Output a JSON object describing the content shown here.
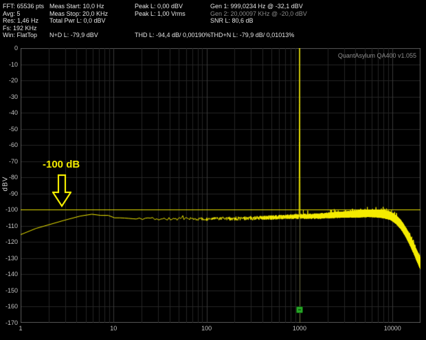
{
  "header": {
    "col1": {
      "rows": [
        "FFT: 65536 pts",
        "Avg: 5",
        "Res: 1,46 Hz",
        "Fs: 192 KHz",
        "Win: FlatTop"
      ]
    },
    "col2": {
      "rows": [
        "Meas Start: 10,0 Hz",
        "Meas Stop: 20,0 KHz",
        "Total Pwr L: 0,0 dBV",
        "",
        "N+D L: -79,9 dBV"
      ]
    },
    "col3": {
      "rows": [
        "Peak L: 0,00 dBV",
        "Peak L: 1,00 Vrms",
        "",
        "",
        "THD L: -94,4 dB/ 0,00190%"
      ]
    },
    "col4": {
      "rows": [
        "Gen 1: 999,0234 Hz @ -32,1 dBV",
        "Gen 2: 20,00097 KHz @ -20,0 dBV",
        "SNR L: 80,6 dB",
        "",
        "THD+N L: -79,9 dB/ 0,01013%"
      ]
    }
  },
  "chart_data": {
    "type": "line",
    "title": "Audio spectrum (FFT) display",
    "watermark": "QuantAsylum QA400 v1.055",
    "bin_width_hz": 1.46,
    "x_axis": {
      "scale": "log",
      "min": 1,
      "max": 20000,
      "ticks": [
        "1",
        "10",
        "100",
        "1000",
        "10000"
      ]
    },
    "y_axis": {
      "label": "dBV",
      "min": -170,
      "max": 0,
      "tick_step": 10,
      "ticks": [
        "0",
        "-10",
        "-20",
        "-30",
        "-40",
        "-50",
        "-60",
        "-70",
        "-80",
        "-90",
        "-100",
        "-110",
        "-120",
        "-130",
        "-140",
        "-150",
        "-160",
        "-170"
      ]
    },
    "reference_line": {
      "value_db": -100,
      "label": "-100 dB",
      "color": "#e8e000"
    },
    "tone": {
      "freq_hz": 1000,
      "peak_dbv": 0
    },
    "gen_marker": {
      "freq_hz": 1000,
      "level_db": -162,
      "color": "#27a327"
    },
    "noise_floor_anchors": [
      [
        1,
        -115
      ],
      [
        1.6,
        -111.5
      ],
      [
        2.2,
        -109
      ],
      [
        3,
        -106.5
      ],
      [
        4,
        -104.5
      ],
      [
        5,
        -103.2
      ],
      [
        6.5,
        -102.8
      ],
      [
        8,
        -103.6
      ],
      [
        10,
        -104.6
      ],
      [
        14,
        -105
      ],
      [
        20,
        -105.4
      ],
      [
        40,
        -105.8
      ],
      [
        90,
        -105.9
      ],
      [
        200,
        -105.6
      ],
      [
        400,
        -105.2
      ],
      [
        700,
        -104.6
      ],
      [
        1000,
        -104.3
      ],
      [
        1600,
        -104.1
      ],
      [
        2500,
        -103.4
      ],
      [
        4000,
        -102.9
      ],
      [
        6000,
        -102.5
      ],
      [
        8000,
        -103
      ],
      [
        9500,
        -104
      ],
      [
        11000,
        -106.5
      ],
      [
        12500,
        -110
      ],
      [
        14000,
        -114.5
      ],
      [
        15500,
        -119.5
      ],
      [
        17000,
        -124.5
      ],
      [
        18500,
        -129.5
      ],
      [
        20000,
        -134
      ]
    ],
    "jitter_anchors": [
      [
        1,
        1
      ],
      [
        6,
        1.4
      ],
      [
        20,
        1.8
      ],
      [
        100,
        2.2
      ],
      [
        400,
        2.6
      ],
      [
        1000,
        3
      ],
      [
        3000,
        4
      ],
      [
        8000,
        5
      ],
      [
        13000,
        5.5
      ],
      [
        20000,
        6.5
      ]
    ],
    "colors": {
      "trace": "#f5ec00",
      "grid": "#262626",
      "grid_decade": "#3a3a3a",
      "border": "#5a5a5a",
      "gen_line": "rgba(190,190,80,0.4)"
    }
  }
}
